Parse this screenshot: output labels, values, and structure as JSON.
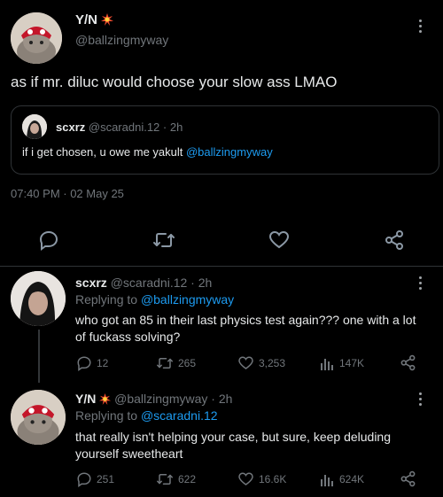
{
  "main_tweet": {
    "display_name": "Y/N",
    "handle": "@ballzingmyway",
    "text": "as if mr. diluc would choose your slow ass LMAO",
    "timestamp": "07:40 PM · 02 May 25",
    "quote": {
      "display_name": "scxrz",
      "handle": "@scaradni.12",
      "time": "2h",
      "text_prefix": "if i get chosen, u owe me yakult ",
      "mention": "@ballzingmyway"
    }
  },
  "replies": [
    {
      "display_name": "scxrz",
      "handle": "@scaradni.12",
      "time": "2h",
      "replying_label": "Replying to ",
      "replying_to": "@ballzingmyway",
      "text": "who got an 85 in their last physics test again??? one with a lot of fuckass solving?",
      "replies": "12",
      "retweets": "265",
      "likes": "3,253",
      "views": "147K"
    },
    {
      "display_name": "Y/N",
      "handle": "@ballzingmyway",
      "time": "2h",
      "replying_label": "Replying to ",
      "replying_to": "@scaradni.12",
      "text": "that really isn't helping your case, but sure, keep deluding yourself sweetheart",
      "replies": "251",
      "retweets": "622",
      "likes": "16.6K",
      "views": "624K"
    }
  ],
  "colors": {
    "background": "#000000",
    "text": "#e7e9ea",
    "muted": "#71767b",
    "link": "#1d9bf0",
    "border": "#2f3336"
  },
  "icons": [
    "explosion-emoji",
    "more-icon",
    "reply-icon",
    "retweet-icon",
    "like-icon",
    "share-icon",
    "views-icon"
  ]
}
